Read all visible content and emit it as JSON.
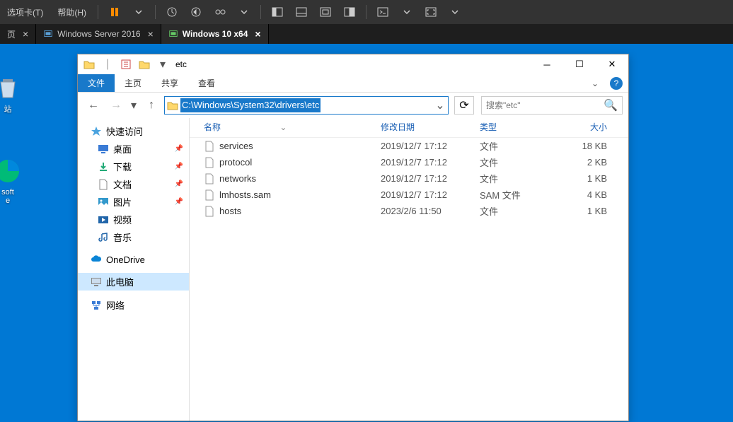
{
  "vm_toolbar": {
    "menu_tabs": "选项卡(T)",
    "menu_help": "帮助(H)"
  },
  "vm_tabs": {
    "tab0_label": "页",
    "tab1_label": "Windows Server 2016",
    "tab2_label": "Windows 10 x64"
  },
  "desktop_icons": {
    "recycle": "站",
    "edge": "soft\ne"
  },
  "explorer": {
    "title": "etc",
    "ribbon": {
      "file": "文件",
      "home": "主页",
      "share": "共享",
      "view": "查看"
    },
    "path": "C:\\Windows\\System32\\drivers\\etc",
    "search_placeholder": "搜索\"etc\"",
    "cols": {
      "name": "名称",
      "date": "修改日期",
      "type": "类型",
      "size": "大小"
    },
    "quick_access": "快速访问",
    "sidebar": {
      "desktop": "桌面",
      "downloads": "下载",
      "documents": "文档",
      "pictures": "图片",
      "videos": "视频",
      "music": "音乐",
      "onedrive": "OneDrive",
      "thispc": "此电脑",
      "network": "网络"
    },
    "files": [
      {
        "name": "services",
        "date": "2019/12/7 17:12",
        "type": "文件",
        "size": "18 KB"
      },
      {
        "name": "protocol",
        "date": "2019/12/7 17:12",
        "type": "文件",
        "size": "2 KB"
      },
      {
        "name": "networks",
        "date": "2019/12/7 17:12",
        "type": "文件",
        "size": "1 KB"
      },
      {
        "name": "lmhosts.sam",
        "date": "2019/12/7 17:12",
        "type": "SAM 文件",
        "size": "4 KB"
      },
      {
        "name": "hosts",
        "date": "2023/2/6 11:50",
        "type": "文件",
        "size": "1 KB"
      }
    ]
  }
}
